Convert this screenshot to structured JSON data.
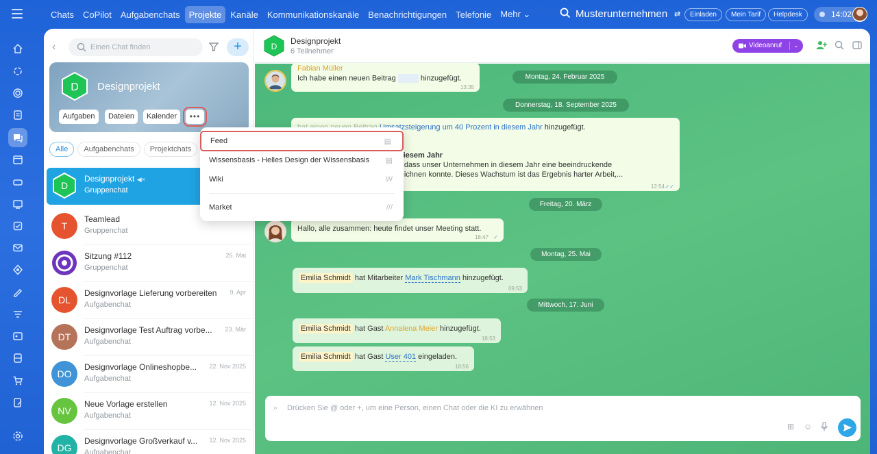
{
  "topbar": {
    "nav": [
      "Chats",
      "CoPilot",
      "Aufgabenchats",
      "Projekte",
      "Kanäle",
      "Kommunikationskanäle",
      "Benachrichtigungen",
      "Telefonie",
      "Mehr ⌄"
    ],
    "active_nav": "Projekte",
    "company": "Musterunternehmen",
    "invite": "Einladen",
    "plan": "Mein Tarif",
    "helpdesk": "Helpdesk",
    "time": "14:02"
  },
  "left": {
    "search_placeholder": "Einen Chat finden",
    "project": {
      "initial": "D",
      "name": "Designprojekt",
      "buttons": [
        "Aufgaben",
        "Dateien",
        "Kalender"
      ],
      "more": "•••"
    },
    "filters": [
      "Alle",
      "Aufgabenchats",
      "Projektchats"
    ],
    "chats": [
      {
        "initial": "D",
        "name": "Designprojekt",
        "sub": "Gruppenchat",
        "date": "",
        "color": "#1ac44e"
      },
      {
        "initial": "T",
        "name": "Teamlead",
        "sub": "Gruppenchat",
        "date": "",
        "color": "#e5542f"
      },
      {
        "initial": "",
        "name": "Sitzung #112",
        "sub": "Gruppenchat",
        "date": "25. Mai",
        "color": "#7a3fc5"
      },
      {
        "initial": "DL",
        "name": "Designvorlage Lieferung vorbereiten",
        "sub": "Aufgabenchat",
        "date": "9. Apr",
        "color": "#e5542f"
      },
      {
        "initial": "DT",
        "name": "Designvorlage Test Auftrag vorbe...",
        "sub": "Aufgabenchat",
        "date": "23. Mär",
        "color": "#b5735a"
      },
      {
        "initial": "DO",
        "name": "Designvorlage Onlineshopbe...",
        "sub": "Aufgabenchat",
        "date": "22. Nov 2025",
        "color": "#3f93d6"
      },
      {
        "initial": "NV",
        "name": "Neue Vorlage erstellen",
        "sub": "Aufgabenchat",
        "date": "12. Nov 2025",
        "color": "#67c43f"
      },
      {
        "initial": "DG",
        "name": "Designvorlage Großverkauf v...",
        "sub": "Aufgabenchat",
        "date": "12. Nov 2025",
        "color": "#22b3a6"
      }
    ]
  },
  "menu": {
    "items": [
      {
        "label": "Feed",
        "icon": "▤"
      },
      {
        "label": "Wissensbasis - Helles Design der Wissensbasis",
        "icon": "▤"
      },
      {
        "label": "Wiki",
        "icon": "W"
      },
      {
        "label": "Market",
        "icon": "///"
      }
    ]
  },
  "chat": {
    "title": "Designprojekt",
    "members": "6 Teilnehmer",
    "video": "Videoanruf",
    "dates": [
      "Montag, 24. Februar 2025",
      "Donnerstag, 18. September 2025",
      "Freitag, 20. März",
      "Montag, 25. Mai",
      "Mittwoch, 17. Juni"
    ],
    "m1": {
      "author": "Fabian Müller",
      "pre": "Ich habe einen neuen Beitrag",
      "post": "hinzugefügt.",
      "time": "13:35"
    },
    "m2": {
      "pre": "hat einen neuen Beitrag",
      "link": "Umsatzsteigerung um 40 Prozent in diesem Jahr",
      "post": "hinzugefügt.",
      "title": "rozent in diesem Jahr",
      "line1": "zu können, dass unser Unternehmen in diesem Jahr eine beeindruckende",
      "line2": "ozent verzeichnen konnte. Dieses Wachstum ist das Ergebnis harter Arbeit,...",
      "time": "12:54"
    },
    "m3": {
      "text": "Hallo, alle zusammen: heute findet unser Meeting statt.",
      "time": "18:47"
    },
    "m4": {
      "name": "Emilia Schmidt",
      "pre": "hat Mitarbeiter",
      "link": "Mark Tischmann",
      "post": "hinzugefügt.",
      "time": "09:53"
    },
    "m5": {
      "name": "Emilia Schmidt",
      "pre": "hat Gast",
      "link": "Annalena Meier",
      "post": "hinzugefügt.",
      "time": "18:53"
    },
    "m6": {
      "name": "Emilia Schmidt",
      "pre": "hat Gast",
      "link": "User 401",
      "post": "eingeladen.",
      "time": "18:56"
    },
    "input_placeholder": "Drücken Sie @ oder +, um eine Person, einen Chat oder die KI zu erwähnen"
  }
}
